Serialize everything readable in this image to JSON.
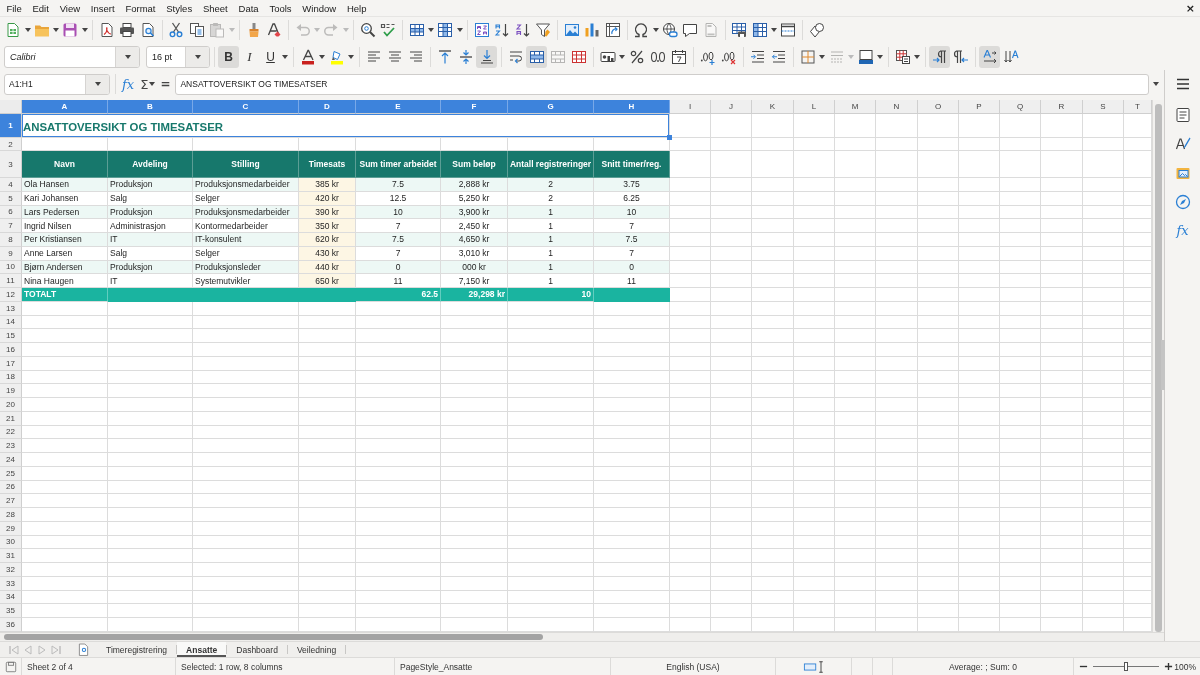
{
  "window": {
    "close": "×"
  },
  "menu": [
    "File",
    "Edit",
    "View",
    "Insert",
    "Format",
    "Styles",
    "Sheet",
    "Data",
    "Tools",
    "Window",
    "Help"
  ],
  "standard_toolbar": {
    "disabled": {
      "paste": true,
      "undo": true,
      "redo": true,
      "headers_footers": true
    }
  },
  "formatting": {
    "font_name": "Calibri",
    "font_size": "16 pt",
    "text_styles": [
      {
        "label": "B",
        "pressed": true
      },
      {
        "label": "I",
        "pressed": false
      },
      {
        "label": "U",
        "pressed": false
      }
    ],
    "toggles": {
      "align_left": false,
      "align_center": false,
      "align_right": false,
      "align_top": false,
      "align_middle": false,
      "align_bottom": true,
      "wrap_text": false,
      "merge_center": true,
      "left_to_right": true,
      "right_to_left": false,
      "text_horizontal": true,
      "text_vertical": false
    },
    "disabled": {
      "merge_cells": true,
      "border_style": true
    }
  },
  "formula_bar": {
    "name_box": "A1:H1",
    "function_wizard": "fx",
    "sum": "Σ",
    "equals": "=",
    "content": "ANSATTOVERSIKT OG TIMESATSER"
  },
  "sidebar": {
    "functions": "fx"
  },
  "columns": [
    {
      "label": "A",
      "selected": true
    },
    {
      "label": "B",
      "selected": true
    },
    {
      "label": "C",
      "selected": true
    },
    {
      "label": "D",
      "selected": true
    },
    {
      "label": "E",
      "selected": true
    },
    {
      "label": "F",
      "selected": true
    },
    {
      "label": "G",
      "selected": true
    },
    {
      "label": "H",
      "selected": true
    },
    {
      "label": "I",
      "selected": false
    },
    {
      "label": "J",
      "selected": false
    },
    {
      "label": "K",
      "selected": false
    },
    {
      "label": "L",
      "selected": false
    },
    {
      "label": "M",
      "selected": false
    },
    {
      "label": "N",
      "selected": false
    },
    {
      "label": "O",
      "selected": false
    },
    {
      "label": "P",
      "selected": false
    },
    {
      "label": "Q",
      "selected": false
    },
    {
      "label": "R",
      "selected": false
    },
    {
      "label": "S",
      "selected": false
    },
    {
      "label": "T",
      "selected": false
    }
  ],
  "row_headers": [
    {
      "label": "1",
      "selected": true
    },
    {
      "label": "2",
      "selected": false
    },
    {
      "label": "3",
      "selected": false
    },
    {
      "label": "4",
      "selected": false
    },
    {
      "label": "5",
      "selected": false
    },
    {
      "label": "6",
      "selected": false
    },
    {
      "label": "7",
      "selected": false
    },
    {
      "label": "8",
      "selected": false
    },
    {
      "label": "9",
      "selected": false
    },
    {
      "label": "10",
      "selected": false
    },
    {
      "label": "11",
      "selected": false
    },
    {
      "label": "12",
      "selected": false
    },
    {
      "label": "13",
      "selected": false
    },
    {
      "label": "14",
      "selected": false
    },
    {
      "label": "15",
      "selected": false
    },
    {
      "label": "16",
      "selected": false
    },
    {
      "label": "17",
      "selected": false
    },
    {
      "label": "18",
      "selected": false
    },
    {
      "label": "19",
      "selected": false
    },
    {
      "label": "20",
      "selected": false
    },
    {
      "label": "21",
      "selected": false
    },
    {
      "label": "22",
      "selected": false
    },
    {
      "label": "23",
      "selected": false
    },
    {
      "label": "24",
      "selected": false
    },
    {
      "label": "25",
      "selected": false
    },
    {
      "label": "26",
      "selected": false
    },
    {
      "label": "27",
      "selected": false
    },
    {
      "label": "28",
      "selected": false
    },
    {
      "label": "29",
      "selected": false
    },
    {
      "label": "30",
      "selected": false
    },
    {
      "label": "31",
      "selected": false
    },
    {
      "label": "32",
      "selected": false
    },
    {
      "label": "33",
      "selected": false
    },
    {
      "label": "34",
      "selected": false
    },
    {
      "label": "35",
      "selected": false
    },
    {
      "label": "36",
      "selected": false
    }
  ],
  "sheet": {
    "title": {
      "text": "ANSATTOVERSIKT OG TIMESATSER",
      "selected": true
    },
    "header": [
      "Navn",
      "Avdeling",
      "Stilling",
      "Timesats",
      "Sum timer arbeidet",
      "Sum beløp",
      "Antall registreringer",
      "Snitt timer/reg."
    ],
    "rows": [
      [
        "Ola Hansen",
        "Produksjon",
        "Produksjonsmedarbeider",
        "385 kr",
        "7.5",
        "2,888 kr",
        "2",
        "3.75"
      ],
      [
        "Kari Johansen",
        "Salg",
        "Selger",
        "420 kr",
        "12.5",
        "5,250 kr",
        "2",
        "6.25"
      ],
      [
        "Lars Pedersen",
        "Produksjon",
        "Produksjonsmedarbeider",
        "390 kr",
        "10",
        "3,900 kr",
        "1",
        "10"
      ],
      [
        "Ingrid Nilsen",
        "Administrasjon",
        "Kontormedarbeider",
        "350 kr",
        "7",
        "2,450 kr",
        "1",
        "7"
      ],
      [
        "Per Kristiansen",
        "IT",
        "IT-konsulent",
        "620 kr",
        "7.5",
        "4,650 kr",
        "1",
        "7.5"
      ],
      [
        "Anne Larsen",
        "Salg",
        "Selger",
        "430 kr",
        "7",
        "3,010 kr",
        "1",
        "7"
      ],
      [
        "Bjørn Andersen",
        "Produksjon",
        "Produksjonsleder",
        "440 kr",
        "0",
        "000 kr",
        "1",
        "0"
      ],
      [
        "Nina Haugen",
        "IT",
        "Systemutvikler",
        "650 kr",
        "11",
        "7,150 kr",
        "1",
        "11"
      ]
    ],
    "total": {
      "label": "TOTALT",
      "hours": "62.5",
      "amount": "29,298 kr",
      "registrations": "10"
    }
  },
  "sheet_tabs": [
    {
      "label": "Timeregistrering",
      "selected": false
    },
    {
      "label": "Ansatte",
      "selected": true
    },
    {
      "label": "Dashboard",
      "selected": false
    },
    {
      "label": "Veiledning",
      "selected": false
    }
  ],
  "status_bar": {
    "sheet": "Sheet 2 of 4",
    "selection": "Selected: 1 row, 8 columns",
    "page_style": "PageStyle_Ansatte",
    "language": "English (USA)",
    "summary": "Average: ; Sum: 0",
    "zoom": {
      "level": 0.5,
      "label": "100%"
    }
  }
}
